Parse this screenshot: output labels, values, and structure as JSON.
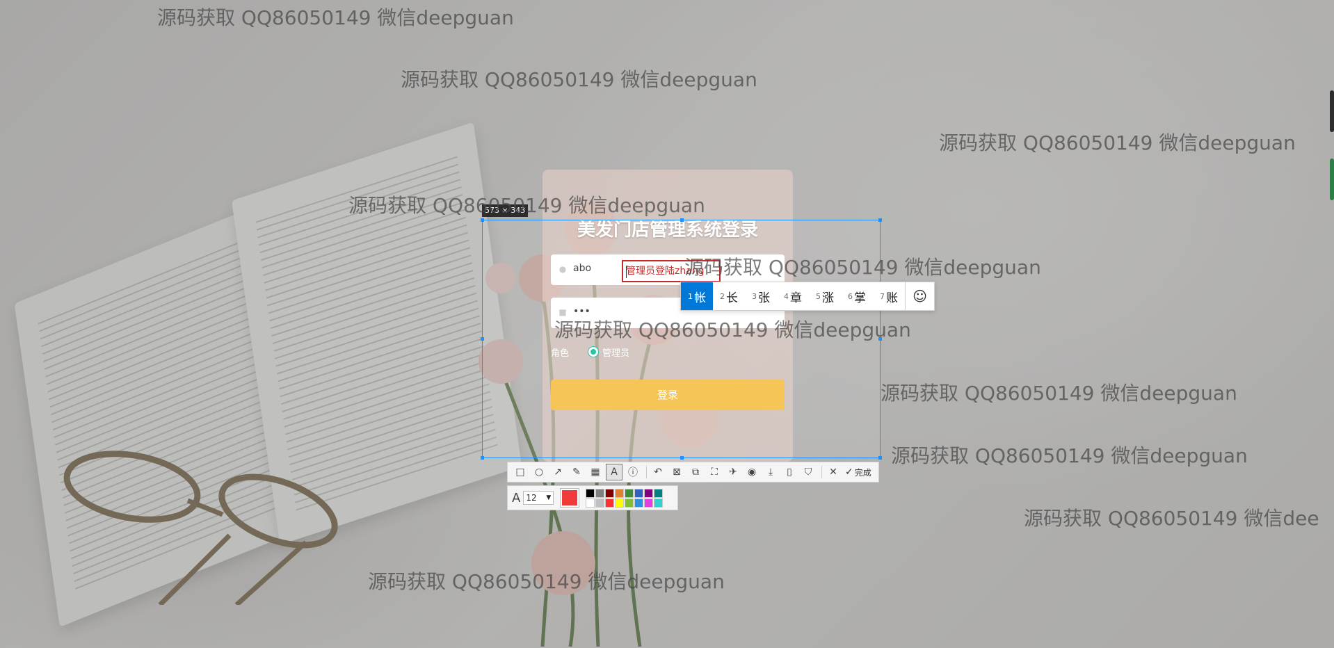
{
  "selection": {
    "size_label": "573 × 343"
  },
  "login": {
    "title": "美发门店管理系统登录",
    "username_value": "abo",
    "password_value": "•••",
    "role_label": "角色",
    "role_option": "管理员",
    "login_button": "登录"
  },
  "annotation": {
    "text": "管理员登陆zhang"
  },
  "ime": {
    "candidates": [
      {
        "num": "1",
        "char": "帐"
      },
      {
        "num": "2",
        "char": "长"
      },
      {
        "num": "3",
        "char": "张"
      },
      {
        "num": "4",
        "char": "章"
      },
      {
        "num": "5",
        "char": "涨"
      },
      {
        "num": "6",
        "char": "掌"
      },
      {
        "num": "7",
        "char": "账"
      }
    ],
    "emoji": "☺"
  },
  "toolbar": {
    "tools": [
      "rectangle-icon",
      "ellipse-icon",
      "arrow-icon",
      "pen-icon",
      "mosaic-icon",
      "text-icon",
      "serial-number-icon",
      "undo-icon",
      "ocr-icon",
      "translate-icon",
      "scroll-capture-icon",
      "pin-icon",
      "record-icon",
      "download-icon",
      "save-icon",
      "bookmark-icon"
    ],
    "cancel_icon": "close-icon",
    "done_label": "完成"
  },
  "text_options": {
    "font_size": "12",
    "current_color": "#f13a3a",
    "palette": [
      "#000000",
      "#808080",
      "#800000",
      "#e08030",
      "#3c8c3c",
      "#3060c0",
      "#800080",
      "#008080",
      "#ffffff",
      "#c0c0c0",
      "#ff3030",
      "#ffff00",
      "#80c030",
      "#3090e0",
      "#e040e0",
      "#30d0d0"
    ]
  },
  "watermarks": [
    "源码获取 QQ86050149 微信deepguan",
    "源码获取 QQ86050149 微信deepguan",
    "源码获取 QQ86050149 微信deepguan",
    "源码获取 QQ86050149 微信deepguan",
    "源码获取 QQ86050149 微信deepguan",
    "源码获取 QQ86050149 微信deepguan",
    "源码获取 QQ86050149 微信deepguan",
    "源码获取 QQ86050149 微信deepguan",
    "源码获取 QQ86050149 微信deepguan",
    "源码获取 QQ86050149 微信dee",
    "源码获取 QQ86050149 微信deepguan"
  ]
}
